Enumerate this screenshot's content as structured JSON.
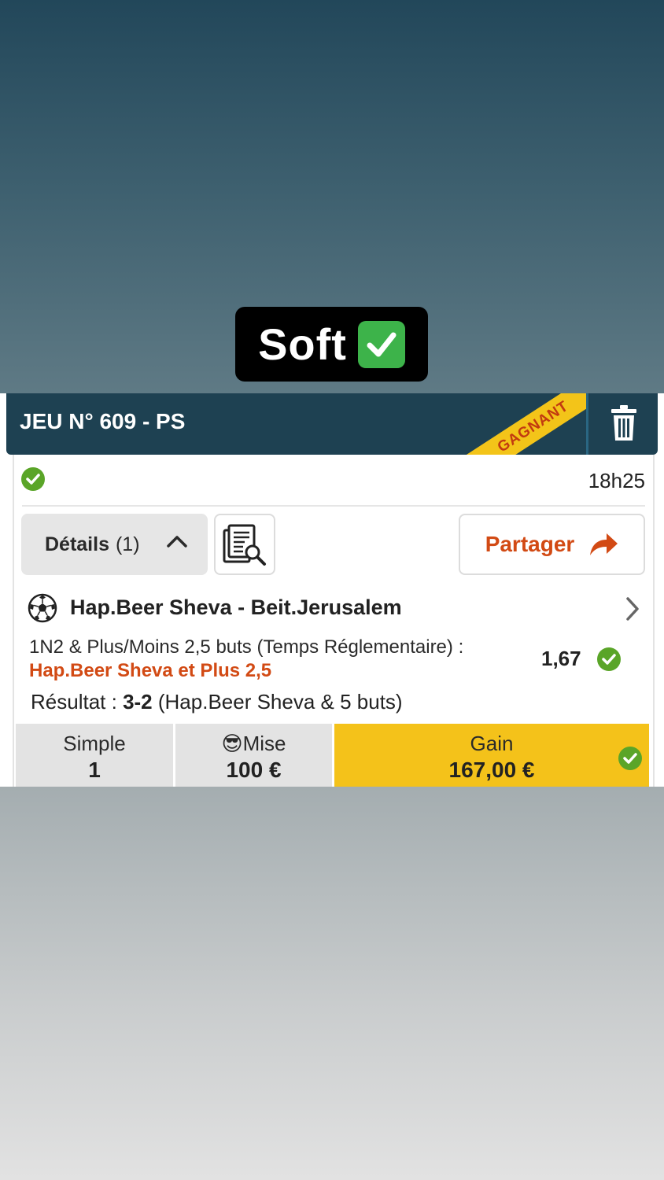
{
  "overlay": {
    "caption": "Soft",
    "caption_emoji": "✅"
  },
  "bet": {
    "title": "JEU N° 609 - PS",
    "status_ribbon": "GAGNANT",
    "time": "18h25",
    "details_label": "Détails",
    "details_count": "(1)",
    "share_label": "Partager",
    "match": "Hap.Beer Sheva - Beit.Jerusalem",
    "market": "1N2 & Plus/Moins 2,5 buts (Temps Réglementaire) :",
    "selection": "Hap.Beer Sheva et Plus 2,5",
    "odds": "1,67",
    "result_prefix": "Résultat : ",
    "result_score": "3-2",
    "result_detail": " (Hap.Beer Sheva & 5 buts)",
    "footer": {
      "type_label": "Simple",
      "type_value": "1",
      "stake_emoji": "😎",
      "stake_label": "Mise",
      "stake_value": "100 €",
      "gain_label": "Gain",
      "gain_value": "167,00 €"
    }
  },
  "colors": {
    "header_bg": "#1e4152",
    "ribbon_bg": "#f3c419",
    "accent_orange": "#d24a14",
    "success_green": "#5aa528",
    "gain_bg": "#f4c21a"
  },
  "icons": [
    "check-circle-icon",
    "trash-icon",
    "chevron-up-icon",
    "document-search-icon",
    "share-arrow-icon",
    "soccer-ball-icon",
    "chevron-right-icon"
  ]
}
